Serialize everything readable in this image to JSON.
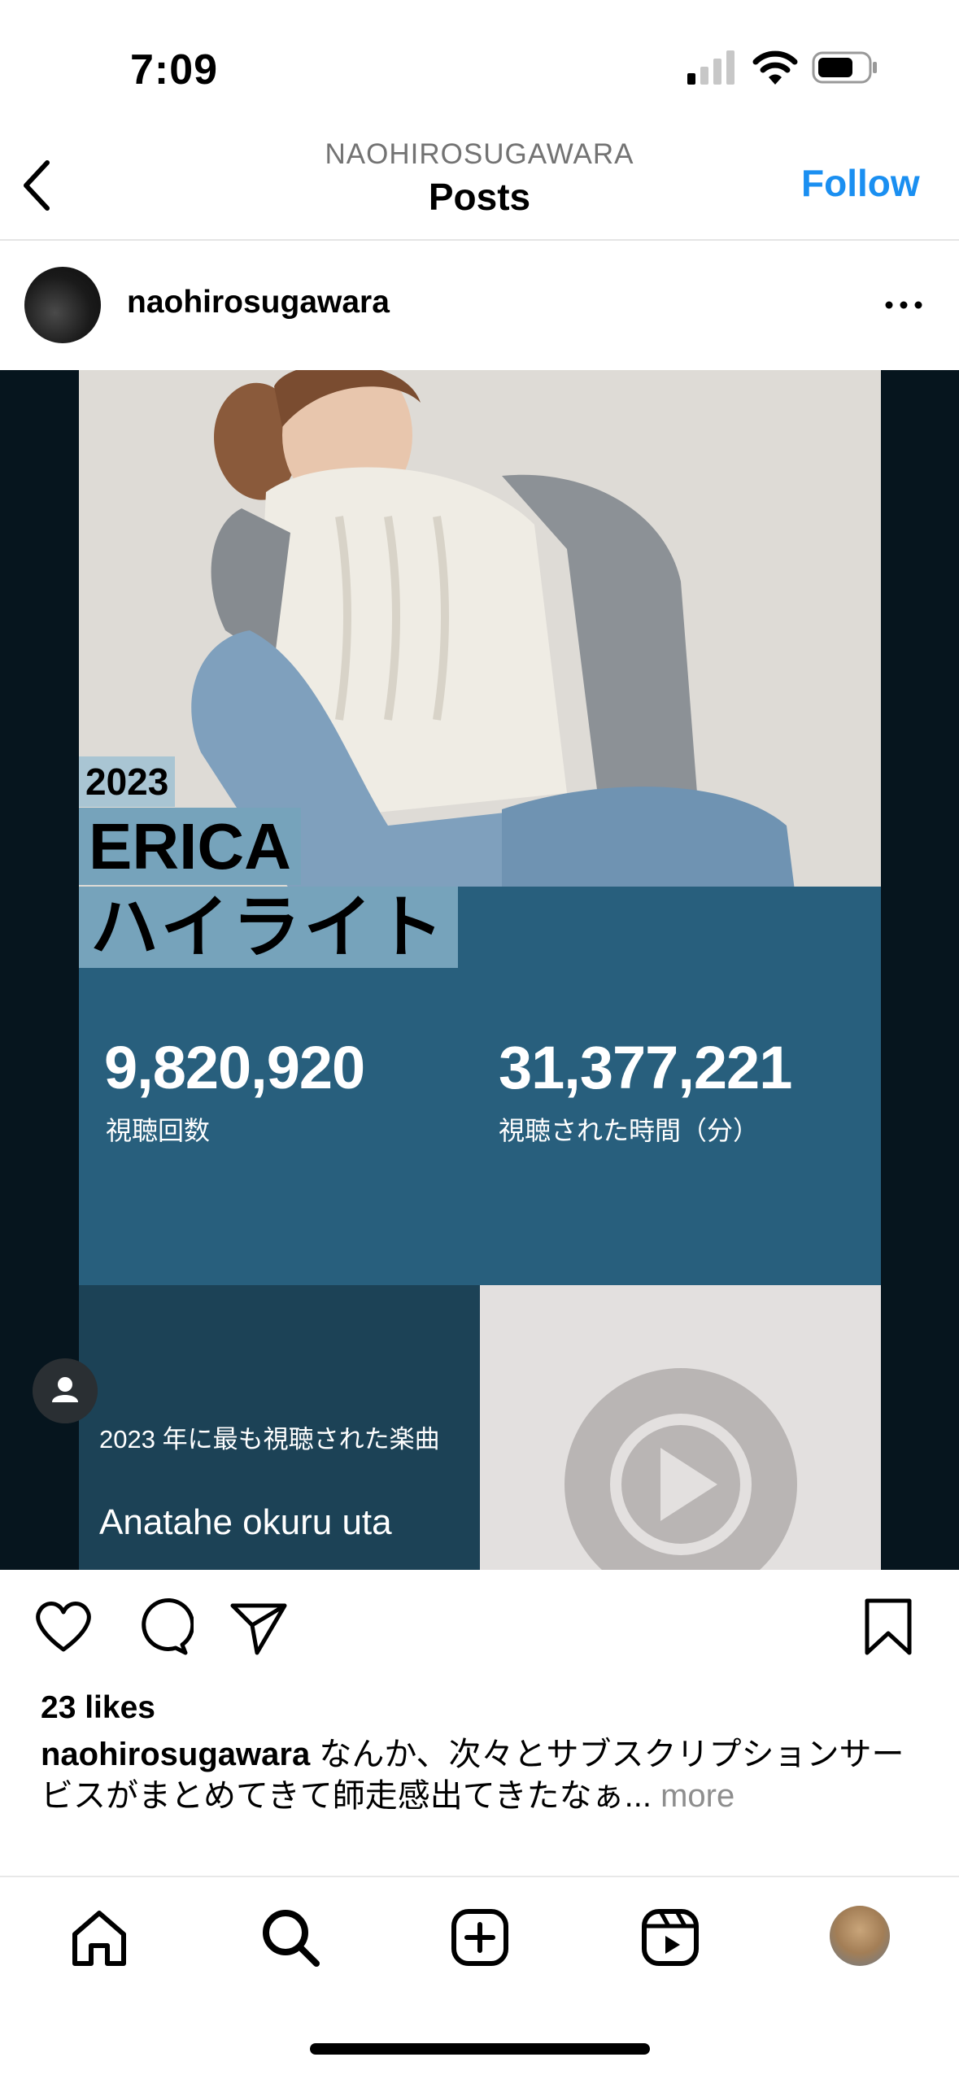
{
  "status_bar": {
    "time": "7:09"
  },
  "header": {
    "username": "NAOHIROSUGAWARA",
    "title": "Posts",
    "follow_label": "Follow"
  },
  "post": {
    "username": "naohirosugawara",
    "media": {
      "year": "2023",
      "artist": "ERICA",
      "highlight": "ハイライト",
      "stat1_value": "9,820,920",
      "stat1_label": "視聴回数",
      "stat2_value": "31,377,221",
      "stat2_label": "視聴された時間（分）",
      "song_caption": "2023 年に最も視聴された楽曲",
      "song_name": "Anatahe okuru uta"
    },
    "likes": "23 likes",
    "caption_user": "naohirosugawara",
    "caption_text": " なんか、次々とサブスクリプションサービスがまとめてきて師走感出てきたなぁ...",
    "caption_more": " more"
  },
  "icons": {
    "back": "chevron-left-icon",
    "more": "more-horizontal-icon",
    "like": "heart-icon",
    "comment": "comment-icon",
    "share": "paper-plane-icon",
    "save": "bookmark-icon",
    "home": "home-icon",
    "search": "search-icon",
    "create": "plus-square-icon",
    "reels": "reels-icon"
  },
  "colors": {
    "accent": "#1a8ff1",
    "panel_blue": "#285f7d",
    "panel_dark": "#1c4256"
  }
}
